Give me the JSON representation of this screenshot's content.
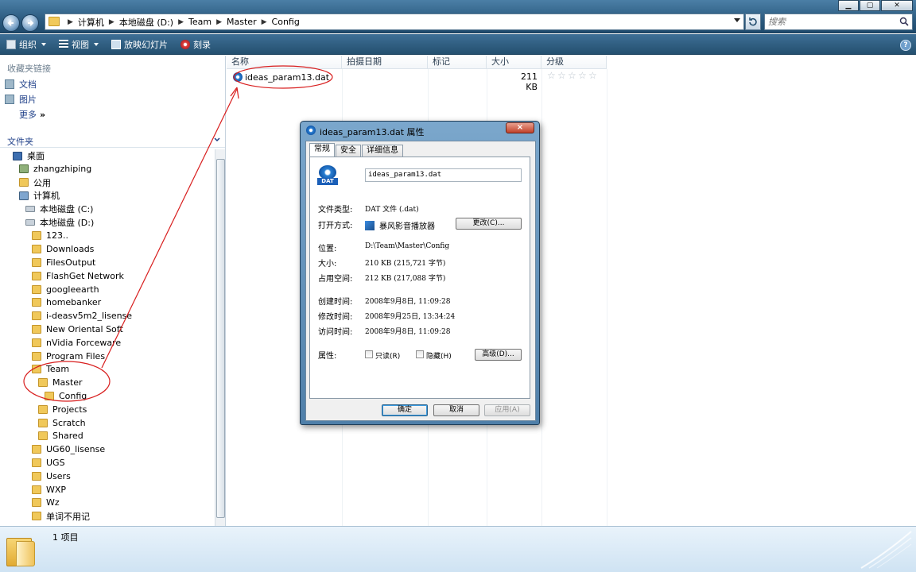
{
  "address_bar": {
    "breadcrumbs": [
      "计算机",
      "本地磁盘 (D:)",
      "Team",
      "Master",
      "Config"
    ],
    "search_placeholder": "搜索"
  },
  "toolbar": {
    "organize": "组织",
    "views": "视图",
    "slideshow": "放映幻灯片",
    "burn": "刻录"
  },
  "sidebar": {
    "favorites_header": "收藏夹链接",
    "favorites": [
      "文档",
      "图片",
      "更多"
    ],
    "more_glyph": "»",
    "folders_header": "文件夹",
    "tree": [
      {
        "label": "桌面",
        "depth": 0
      },
      {
        "label": "zhangzhiping",
        "depth": 1
      },
      {
        "label": "公用",
        "depth": 1
      },
      {
        "label": "计算机",
        "depth": 1
      },
      {
        "label": "本地磁盘 (C:)",
        "depth": 2
      },
      {
        "label": "本地磁盘 (D:)",
        "depth": 2
      },
      {
        "label": "123..",
        "depth": 3
      },
      {
        "label": "Downloads",
        "depth": 3
      },
      {
        "label": "FilesOutput",
        "depth": 3
      },
      {
        "label": "FlashGet Network",
        "depth": 3
      },
      {
        "label": "googleearth",
        "depth": 3
      },
      {
        "label": "homebanker",
        "depth": 3
      },
      {
        "label": "i-deasv5m2_lisense",
        "depth": 3
      },
      {
        "label": "New Oriental Soft",
        "depth": 3
      },
      {
        "label": "nVidia Forceware",
        "depth": 3
      },
      {
        "label": "Program Files",
        "depth": 3
      },
      {
        "label": "Team",
        "depth": 3
      },
      {
        "label": "Master",
        "depth": 4
      },
      {
        "label": "Config",
        "depth": 5
      },
      {
        "label": "Projects",
        "depth": 4
      },
      {
        "label": "Scratch",
        "depth": 4
      },
      {
        "label": "Shared",
        "depth": 4
      },
      {
        "label": "UG60_lisense",
        "depth": 3
      },
      {
        "label": "UGS",
        "depth": 3
      },
      {
        "label": "Users",
        "depth": 3
      },
      {
        "label": "WXP",
        "depth": 3
      },
      {
        "label": "Wz",
        "depth": 3
      },
      {
        "label": "单词不用记",
        "depth": 3
      }
    ]
  },
  "filelist": {
    "columns": [
      "名称",
      "拍摄日期",
      "标记",
      "大小",
      "分级"
    ],
    "files": [
      {
        "name": "ideas_param13.dat",
        "size": "211 KB",
        "rating": 0
      }
    ]
  },
  "status": {
    "count": "1 项目"
  },
  "dialog": {
    "title": "ideas_param13.dat 属性",
    "tabs": [
      "常规",
      "安全",
      "详细信息"
    ],
    "filename": "ideas_param13.dat",
    "icon_tag": "DAT",
    "close_glyph": "×",
    "rows": {
      "type_label": "文件类型:",
      "type_value": "DAT 文件 (.dat)",
      "opens_label": "打开方式:",
      "opens_value": "暴风影音播放器",
      "change_btn": "更改(C)...",
      "location_label": "位置:",
      "location_value": "D:\\Team\\Master\\Config",
      "size_label": "大小:",
      "size_value": "210 KB (215,721 字节)",
      "disk_label": "占用空间:",
      "disk_value": "212 KB (217,088 字节)",
      "created_label": "创建时间:",
      "created_value": "2008年9月8日, 11:09:28",
      "modified_label": "修改时间:",
      "modified_value": "2008年9月25日, 13:34:24",
      "accessed_label": "访问时间:",
      "accessed_value": "2008年9月8日, 11:09:28",
      "attr_label": "属性:",
      "readonly": "只读(R)",
      "hidden": "隐藏(H)",
      "advanced_btn": "高级(D)..."
    },
    "buttons": {
      "ok": "确定",
      "cancel": "取消",
      "apply": "应用(A)"
    }
  },
  "colors": {
    "chrome_dark": "#24506f",
    "link_blue": "#1e3f88",
    "annotation_red": "#d81e1e"
  }
}
